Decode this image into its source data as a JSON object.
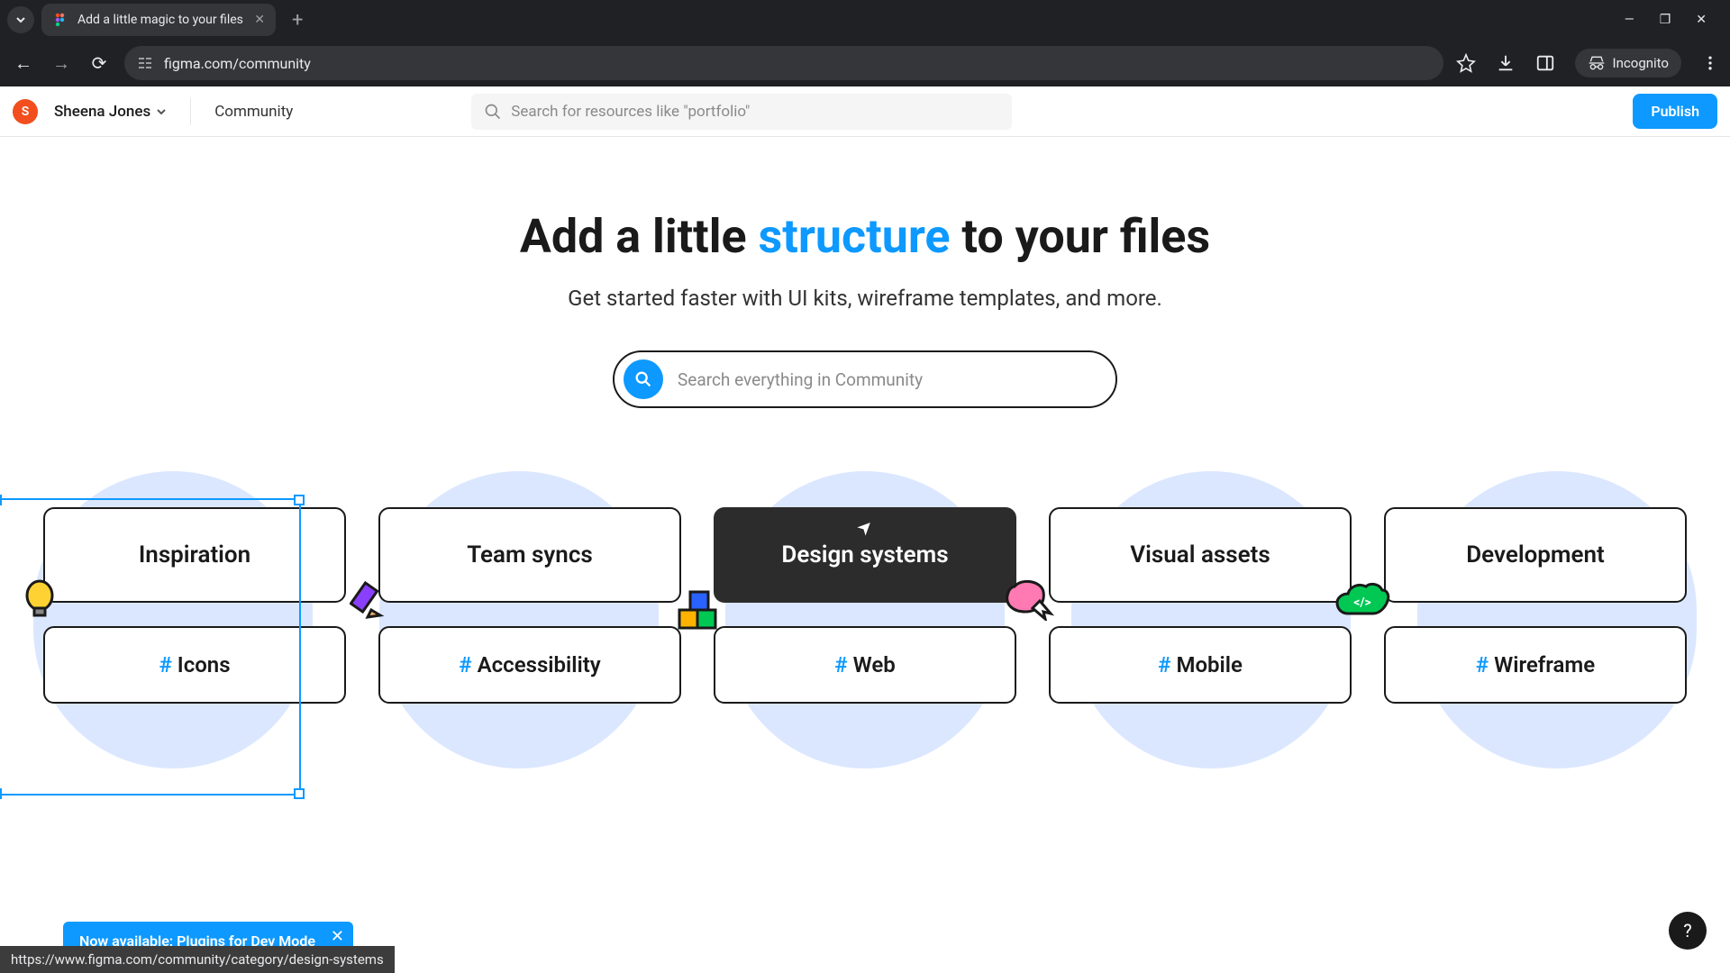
{
  "browser": {
    "tab_title": "Add a little magic to your files",
    "url": "figma.com/community",
    "incognito_label": "Incognito"
  },
  "header": {
    "avatar_initial": "S",
    "user_name": "Sheena Jones",
    "community_label": "Community",
    "search_placeholder": "Search for resources like \"portfolio\"",
    "publish_label": "Publish"
  },
  "hero": {
    "title_prefix": "Add a little ",
    "title_accent": "structure",
    "title_suffix": " to your files",
    "subtitle": "Get started faster with UI kits, wireframe templates, and more.",
    "search_placeholder": "Search everything in Community"
  },
  "categories": {
    "main": [
      "Inspiration",
      "Team syncs",
      "Design systems",
      "Visual assets",
      "Development"
    ],
    "tags": [
      "Icons",
      "Accessibility",
      "Web",
      "Mobile",
      "Wireframe"
    ],
    "hovered_index": 2,
    "hash": "#"
  },
  "banner": {
    "text": "Now available: Plugins for Dev Mode"
  },
  "status_url": "https://www.figma.com/community/category/design-systems",
  "help_label": "?"
}
